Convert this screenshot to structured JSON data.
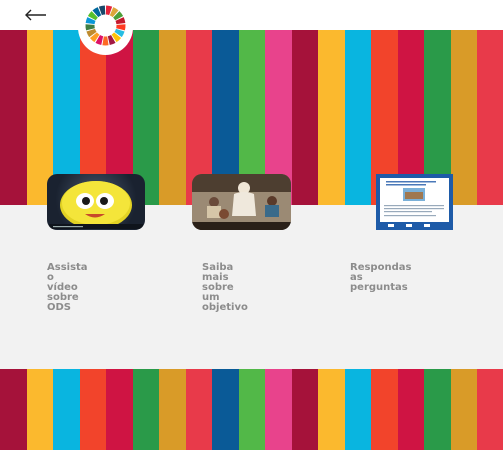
{
  "header": {
    "back_icon": "arrow-left-icon",
    "logo_icon": "sdg-color-wheel-icon"
  },
  "colors": {
    "stripes": [
      "#a5123a",
      "#fbb92e",
      "#09b5e0",
      "#f2442b",
      "#cf1443",
      "#2a9a49",
      "#d99b28",
      "#e83a4a",
      "#0a5a97",
      "#52b848",
      "#e8438c",
      "#a5123a",
      "#fbb92e",
      "#09b5e0",
      "#f2442b",
      "#cf1443",
      "#2a9a49",
      "#d99b28",
      "#e83a4a"
    ],
    "label": "#8c8c8c",
    "background": "#f2f2f2"
  },
  "cards": [
    {
      "label": "Assista o vídeo\nsobre ODS",
      "thumbnail": "animated-character-video-thumbnail"
    },
    {
      "label": "Saiba mais sobre\num objetivo",
      "thumbnail": "classroom-video-thumbnail"
    },
    {
      "label": "Respondas as perguntas",
      "thumbnail": "quiz-screen-thumbnail"
    }
  ]
}
